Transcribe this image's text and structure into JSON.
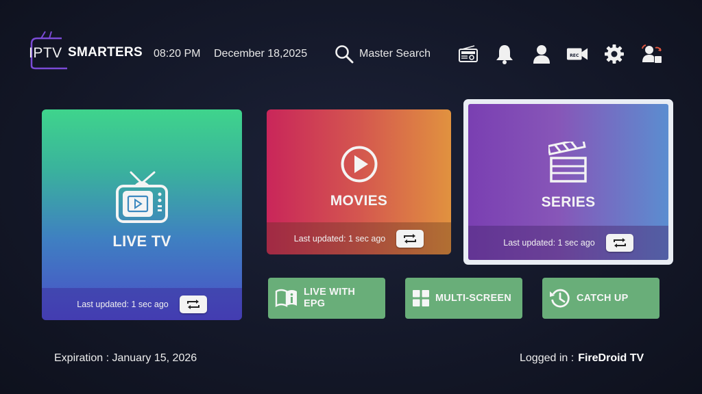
{
  "app": {
    "logo_iptv": "IPTV",
    "logo_smarters": "SMARTERS"
  },
  "header": {
    "time": "08:20 PM",
    "date": "December 18,2025",
    "search_label": "Master Search",
    "icons": [
      "radio-icon",
      "bell-icon",
      "user-icon",
      "record-icon",
      "gear-icon",
      "switch-user-icon"
    ]
  },
  "tiles": {
    "live": {
      "title": "LIVE TV",
      "updated": "Last updated: 1 sec ago"
    },
    "movies": {
      "title": "MOVIES",
      "updated": "Last updated: 1 sec ago"
    },
    "series": {
      "title": "SERIES",
      "updated": "Last updated: 1 sec ago"
    }
  },
  "buttons": {
    "epg_line1": "LIVE WITH",
    "epg_line2": "EPG",
    "multiscreen": "MULTI-SCREEN",
    "catchup": "CATCH UP"
  },
  "footer": {
    "expiration": "Expiration : January 15, 2026",
    "logged_label": "Logged in :",
    "logged_user": "FireDroid TV"
  },
  "colors": {
    "small_button_bg": "#69ae79",
    "accent_frame": "#e9edf4"
  }
}
